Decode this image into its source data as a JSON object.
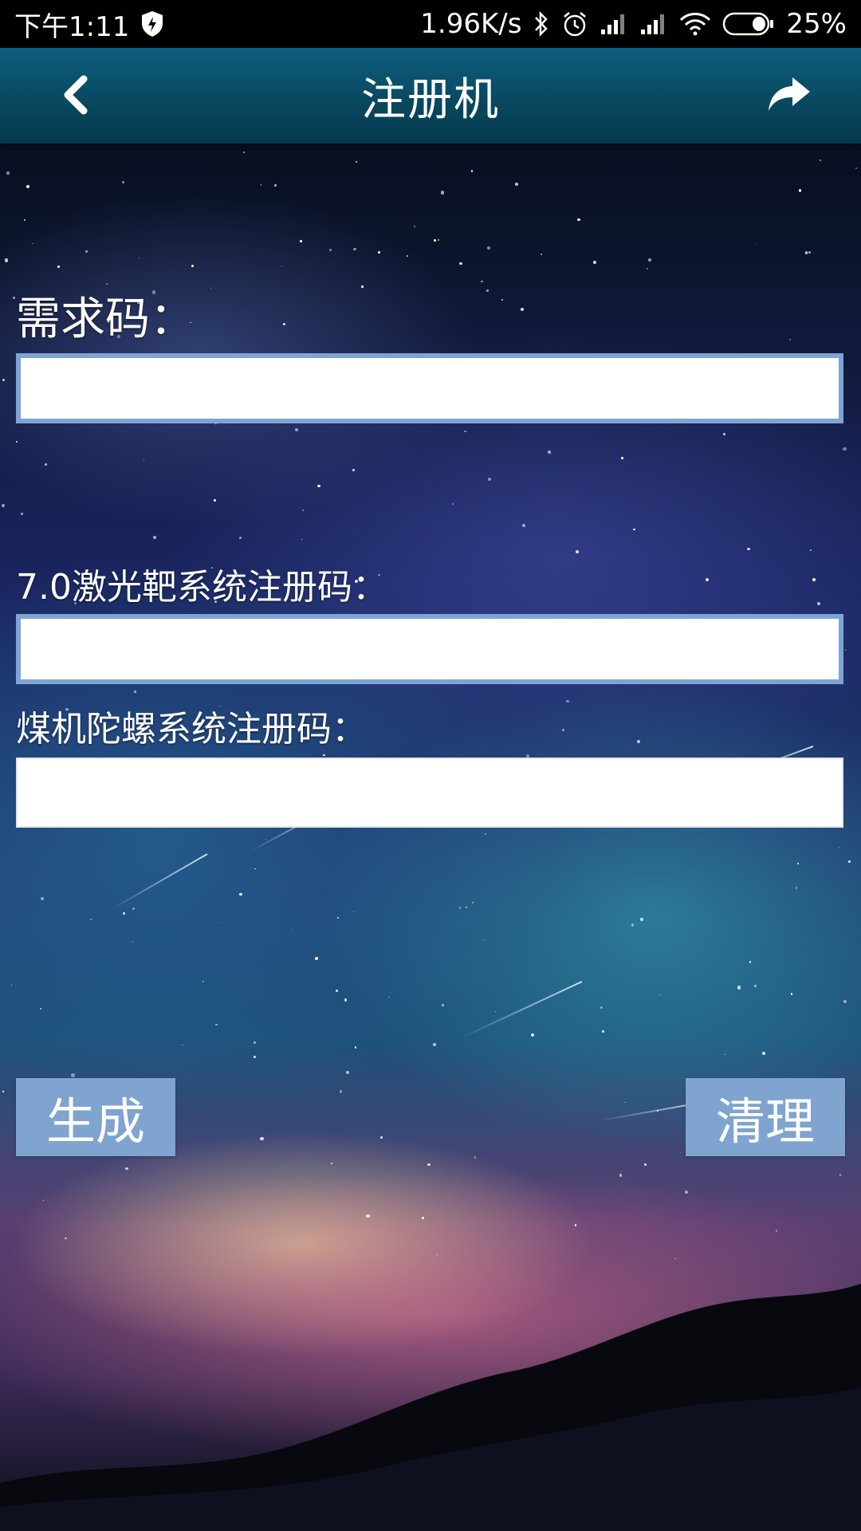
{
  "status_bar": {
    "time": "下午1:11",
    "net_speed": "1.96K/s",
    "battery": "25%",
    "icons": [
      "shield-icon",
      "bluetooth-icon",
      "alarm-icon",
      "signal-icon",
      "signal-icon",
      "wifi-icon",
      "battery-icon"
    ]
  },
  "app_bar": {
    "title": "注册机",
    "back_icon": "chevron-left-icon",
    "share_icon": "share-icon"
  },
  "form": {
    "demand_label": "需求码：",
    "demand_value": "",
    "laser_label": "7.0激光靶系统注册码：",
    "laser_value": "",
    "gyro_label": "煤机陀螺系统注册码：",
    "gyro_value": ""
  },
  "buttons": {
    "generate": "生成",
    "clear": "清理"
  },
  "colors": {
    "app_bar": "#08475e",
    "button": "#7ea4cf",
    "input_border": "#7ea4d4"
  }
}
